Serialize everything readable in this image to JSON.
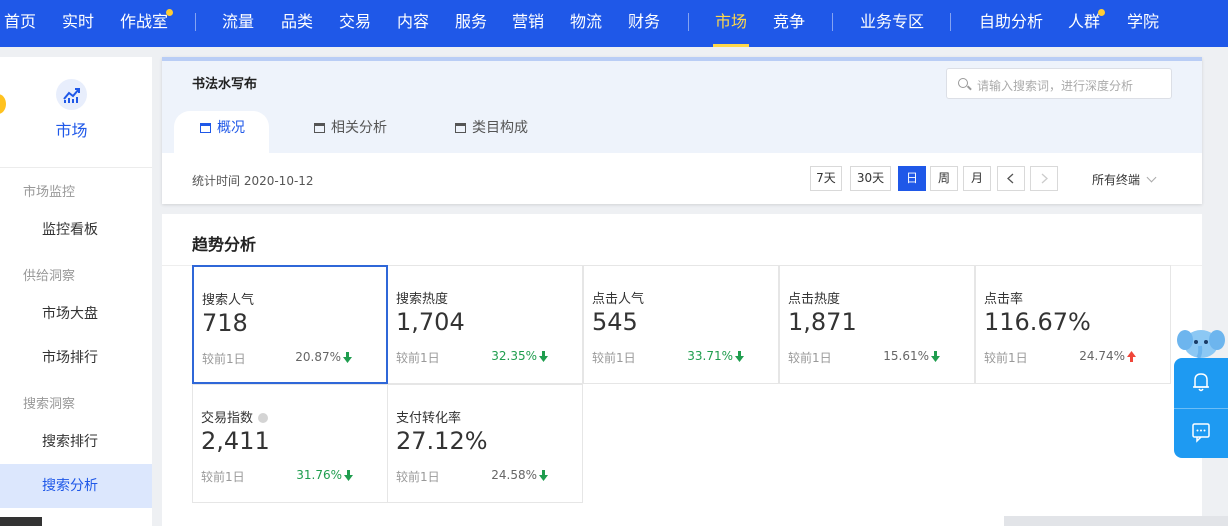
{
  "topnav": {
    "items": [
      {
        "label": "首页"
      },
      {
        "label": "实时"
      },
      {
        "label": "作战室",
        "dot": true
      },
      {
        "label": "流量"
      },
      {
        "label": "品类"
      },
      {
        "label": "交易"
      },
      {
        "label": "内容"
      },
      {
        "label": "服务"
      },
      {
        "label": "营销"
      },
      {
        "label": "物流"
      },
      {
        "label": "财务"
      },
      {
        "label": "市场",
        "active": true
      },
      {
        "label": "竞争"
      },
      {
        "label": "业务专区"
      },
      {
        "label": "自助分析"
      },
      {
        "label": "人群",
        "dot": true
      },
      {
        "label": "学院"
      }
    ],
    "bg_color": "#1f58e8",
    "active_color": "#ffd84a"
  },
  "sidebar": {
    "title": "市场",
    "icon": "market-chart-icon",
    "groups": [
      {
        "label": "市场监控",
        "items": [
          {
            "label": "监控看板"
          }
        ]
      },
      {
        "label": "供给洞察",
        "items": [
          {
            "label": "市场大盘"
          },
          {
            "label": "市场排行"
          }
        ]
      },
      {
        "label": "搜索洞察",
        "items": [
          {
            "label": "搜索排行"
          },
          {
            "label": "搜索分析",
            "active": true
          }
        ]
      }
    ]
  },
  "header": {
    "keyword": "书法水写布",
    "search_placeholder": "请输入搜索词，进行深度分析",
    "tabs": [
      {
        "label": "概况",
        "active": true
      },
      {
        "label": "相关分析"
      },
      {
        "label": "类目构成"
      }
    ],
    "stat_time": "统计时间 2020-10-12",
    "periods": [
      {
        "label": "7天"
      },
      {
        "label": "30天"
      },
      {
        "label": "日",
        "active": true
      },
      {
        "label": "周"
      },
      {
        "label": "月"
      }
    ],
    "terminal": "所有终端"
  },
  "trend": {
    "title": "趋势分析",
    "compare_label": "较前1日",
    "metrics": [
      {
        "label": "搜索人气",
        "value": "718",
        "pct": "20.87%",
        "dir": "down",
        "selected": true
      },
      {
        "label": "搜索热度",
        "value": "1,704",
        "pct": "32.35%",
        "dir": "down",
        "green": true
      },
      {
        "label": "点击人气",
        "value": "545",
        "pct": "33.71%",
        "dir": "down",
        "green": true
      },
      {
        "label": "点击热度",
        "value": "1,871",
        "pct": "15.61%",
        "dir": "down"
      },
      {
        "label": "点击率",
        "value": "116.67%",
        "pct": "24.74%",
        "dir": "up"
      },
      {
        "label": "交易指数",
        "value": "2,411",
        "pct": "31.76%",
        "dir": "down",
        "green": true,
        "info": true
      },
      {
        "label": "支付转化率",
        "value": "27.12%",
        "pct": "24.58%",
        "dir": "down"
      }
    ],
    "down_color": "#1f9d4e",
    "up_color": "#f0463a"
  },
  "float_tools": [
    {
      "icon": "bell-icon"
    },
    {
      "icon": "chat-icon"
    }
  ]
}
